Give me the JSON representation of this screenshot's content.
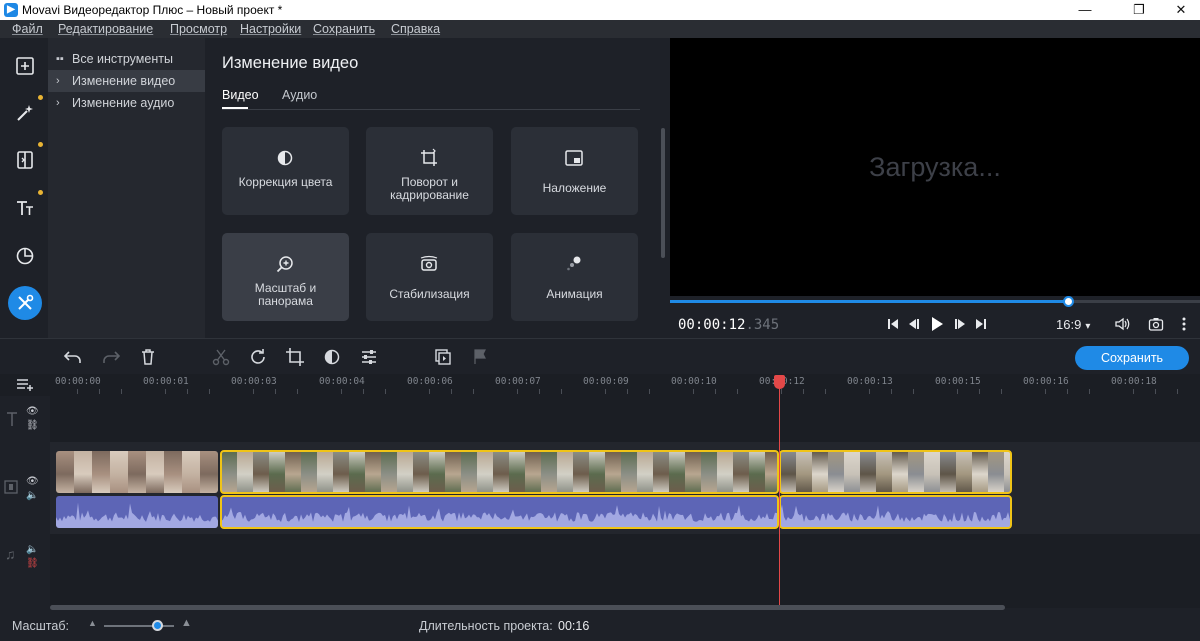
{
  "window": {
    "title": "Movavi Видеоредактор Плюс – Новый проект *",
    "minimize_icon": "minimize-icon",
    "maximize_icon": "restore-icon",
    "close_icon": "close-icon"
  },
  "menu": [
    "Файл",
    "Редактирование",
    "Просмотр",
    "Настройки",
    "Сохранить",
    "Справка"
  ],
  "rail": [
    {
      "name": "import",
      "icon": "add-file-icon",
      "dot": false,
      "active": false
    },
    {
      "name": "filters",
      "icon": "magic-wand-icon",
      "dot": true,
      "active": false
    },
    {
      "name": "transitions",
      "icon": "transition-icon",
      "dot": true,
      "active": false
    },
    {
      "name": "titles",
      "icon": "text-icon",
      "dot": true,
      "active": false
    },
    {
      "name": "stickers",
      "icon": "clock-icon",
      "dot": false,
      "active": false
    },
    {
      "name": "tools",
      "icon": "tools-icon",
      "dot": false,
      "active": true
    }
  ],
  "categories": {
    "all": "Все инструменты",
    "video": "Изменение видео",
    "audio": "Изменение аудио"
  },
  "tools": {
    "heading": "Изменение видео",
    "tab_video": "Видео",
    "tab_audio": "Аудио",
    "tiles": {
      "color": "Коррекция цвета",
      "crop": "Поворот и кадрирование",
      "overlay": "Наложение",
      "zoom": "Масштаб и панорама",
      "stab": "Стабилизация",
      "anim": "Анимация"
    }
  },
  "preview": {
    "loading": "Загрузка...",
    "time_main": "00:00:12",
    "time_ms": ".345",
    "aspect": "16:9",
    "progress": 0.75
  },
  "timeline": {
    "save_label": "Сохранить",
    "ruler": [
      "00:00:00",
      "00:00:01",
      "00:00:03",
      "00:00:04",
      "00:00:06",
      "00:00:07",
      "00:00:09",
      "00:00:10",
      "00:00:12",
      "00:00:13",
      "00:00:15",
      "00:00:16",
      "00:00:18"
    ],
    "playhead_time": "00:00:12"
  },
  "status": {
    "zoom_label": "Масштаб:",
    "zoom_level": 0.75,
    "duration_label": "Длительность проекта:",
    "duration_value": "00:16"
  },
  "colors": {
    "accent": "#1f8ae6",
    "selection": "#f0c417",
    "playhead": "#e34848",
    "audio_wave": "#5d65b6"
  }
}
